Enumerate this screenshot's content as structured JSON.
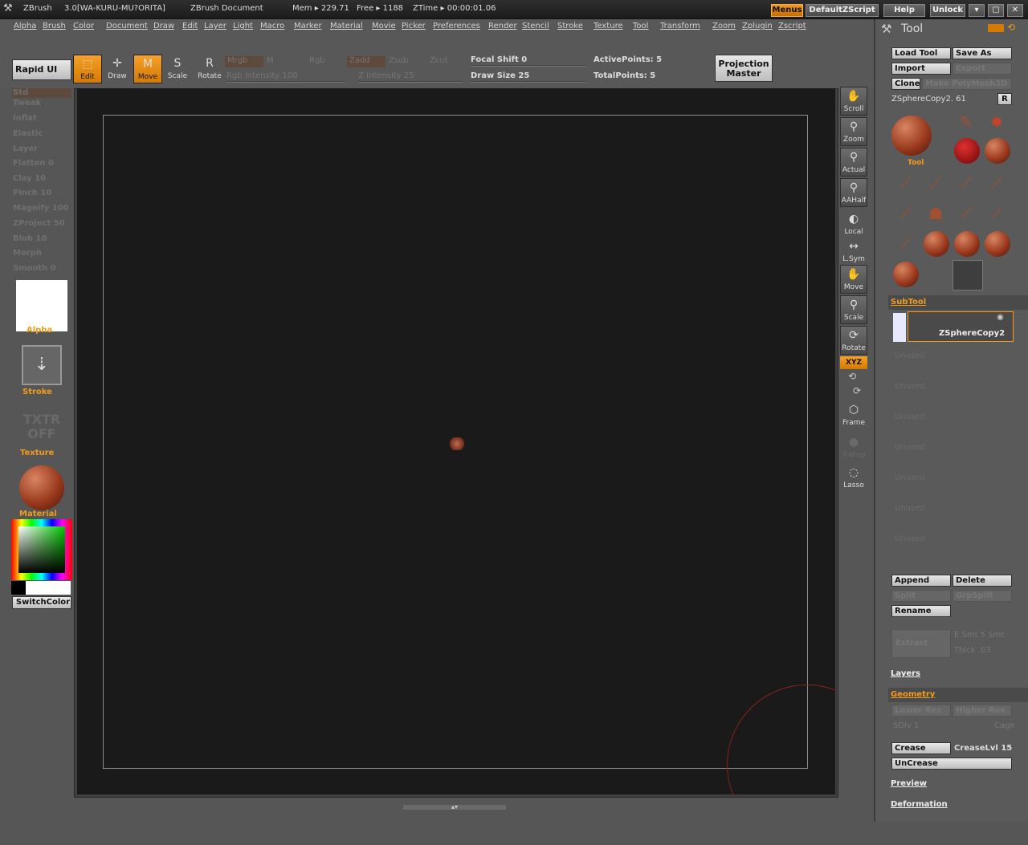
{
  "titlebar": {
    "app": "ZBrush",
    "version": "3.0[WA-KURU-MU?ORITA]",
    "document": "ZBrush Document",
    "mem": "Mem ▸ 229.71",
    "free": "Free ▸ 1188",
    "ztime": "ZTime ▸ 00:00:01.06",
    "buttons": {
      "menus": "Menus",
      "script": "DefaultZScript",
      "help": "Help",
      "unlock": "Unlock",
      "min": "▾",
      "max": "▢",
      "close": "✕"
    }
  },
  "menus": [
    "Alpha",
    "Brush",
    "Color",
    "Document",
    "Draw",
    "Edit",
    "Layer",
    "Light",
    "Macro",
    "Marker",
    "Material",
    "Movie",
    "Picker",
    "Preferences",
    "Render",
    "Stencil",
    "Stroke",
    "Texture",
    "Tool",
    "Transform",
    "Zoom",
    "Zplugin",
    "Zscript"
  ],
  "topshelf": {
    "rapid_ui": "Rapid UI",
    "edit": "Edit",
    "draw": "Draw",
    "move": "Move",
    "scale": "Scale",
    "rotate": "Rotate",
    "mrgb": "Mrgb",
    "m": "M",
    "rgb": "Rgb",
    "rgb_intensity": "Rgb Intensity 100",
    "zadd": "Zadd",
    "zsub": "Zsub",
    "zcut": "Zcut",
    "z_intensity": "Z Intensity 25",
    "focal_shift": "Focal Shift 0",
    "draw_size": "Draw Size 25",
    "active_points": "ActivePoints: 5",
    "total_points": "TotalPoints: 5",
    "projection_master_1": "Projection",
    "projection_master_2": "Master"
  },
  "leftshelf": {
    "items": [
      "Std",
      "Tweak",
      "Inflat",
      "Elastic",
      "Layer",
      "Flatten 0",
      "Clay 10",
      "Pinch 10",
      "Magnify 100",
      "ZProject 50",
      "Blob 10",
      "Morph",
      "Smooth 0"
    ],
    "alpha": "Alpha",
    "stroke": "Stroke",
    "texture_1": "TXTR",
    "texture_2": "OFF",
    "texture": "Texture",
    "material": "Material",
    "switchcolor": "SwitchColor"
  },
  "rightshelf": [
    "Scroll",
    "Zoom",
    "Actual",
    "AAHalf",
    "Local",
    "L.Sym",
    "Move",
    "Scale",
    "Rotate",
    "XYZ",
    "Frame",
    "Transp",
    "Lasso"
  ],
  "toolpanel": {
    "title": "Tool",
    "load": "Load Tool",
    "save": "Save As",
    "import": "Import",
    "export": "Export",
    "clone": "Clone",
    "polymesh": "Make PolyMesh3D",
    "current": "ZSphereCopy2. 61",
    "r": "R",
    "tool_label": "Tool",
    "subtool": "SubTool",
    "subtool_name": "ZSphereCopy2",
    "unused": [
      "Unused",
      "Unused",
      "Unused",
      "Unused",
      "Unused",
      "Unused",
      "Unused"
    ],
    "append": "Append",
    "delete": "Delete",
    "split": "Split",
    "grpsplit": "GrpSplit",
    "rename": "Rename",
    "extract": "Extract",
    "esmt": "E.Smt 5 Smt",
    "thick": "Thick .03",
    "layers": "Layers",
    "geometry": "Geometry",
    "lower": "Lower Res",
    "higher": "Higher Res",
    "sdiv": "SDiv 1",
    "cage": "Cage",
    "crease": "Crease",
    "creaselvl": "CreaseLvl 15",
    "uncrease": "UnCrease",
    "preview": "Preview",
    "deformation": "Deformation"
  }
}
